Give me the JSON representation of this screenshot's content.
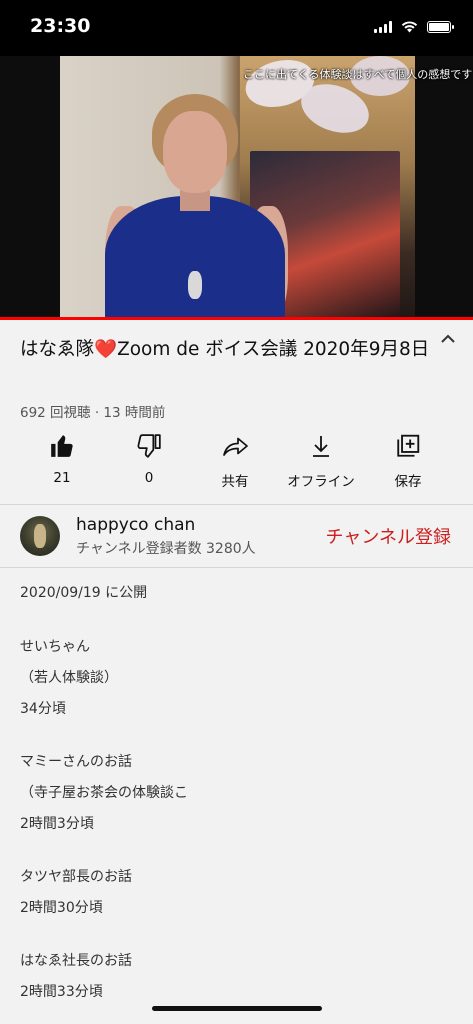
{
  "status_bar": {
    "time": "23:30",
    "battery_level": 1.0
  },
  "video": {
    "overlay_text": "ここに出てくる体験談はすべて個人の感想です",
    "progress": 1.0,
    "progress_color": "#ff0000"
  },
  "title": {
    "before_heart": "はなゑ隊",
    "heart": "❤️",
    "after_heart": "Zoom de ボイス会議 2020年9月8日"
  },
  "meta": "692 回視聴 · 13 時間前",
  "actions": [
    {
      "icon": "thumbs-up-icon",
      "label": "21"
    },
    {
      "icon": "thumbs-down-icon",
      "label": "0"
    },
    {
      "icon": "share-icon",
      "label": "共有"
    },
    {
      "icon": "download-icon",
      "label": "オフライン"
    },
    {
      "icon": "save-icon",
      "label": "保存"
    }
  ],
  "channel": {
    "name": "happyco chan",
    "subscribers": "チャンネル登録者数 3280人",
    "subscribe_label": "チャンネル登録",
    "subscribe_color": "#cc1f1f"
  },
  "description": {
    "published": "2020/09/19 に公開",
    "lines": [
      "せいちゃん",
      "（若人体験談）",
      "34分頃",
      "マミーさんのお話",
      "（寺子屋お茶会の体験談こ",
      "2時間3分頃",
      "タツヤ部長のお話",
      "2時間30分頃",
      "はなゑ社長のお話",
      "2時間33分頃"
    ]
  }
}
